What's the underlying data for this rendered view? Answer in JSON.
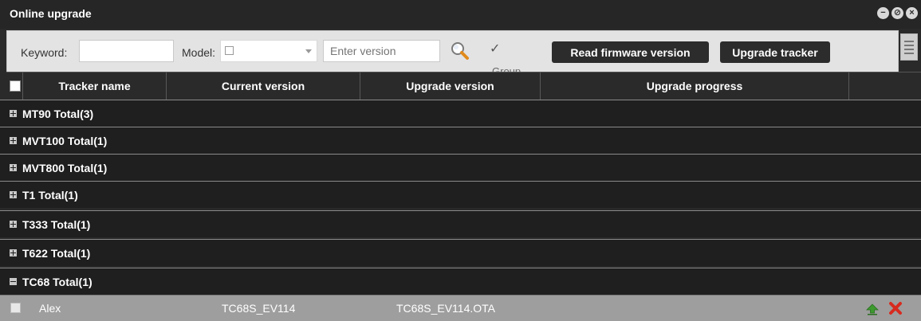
{
  "window": {
    "title": "Online upgrade",
    "controls": [
      "minimize",
      "restore",
      "close"
    ]
  },
  "toolbar": {
    "keyword_label": "Keyword:",
    "keyword_value": "",
    "model_label": "Model:",
    "version_placeholder": "Enter version",
    "group_label": "Group",
    "group_checked": true,
    "read_firmware_label": "Read firmware version",
    "upgrade_tracker_label": "Upgrade tracker"
  },
  "table": {
    "headers": [
      "Tracker name",
      "Current version",
      "Upgrade version",
      "Upgrade progress",
      ""
    ],
    "groups": [
      {
        "label": "MT90 Total(3)",
        "expanded": false
      },
      {
        "label": "MVT100 Total(1)",
        "expanded": false
      },
      {
        "label": "MVT800 Total(1)",
        "expanded": false
      },
      {
        "label": "T1 Total(1)",
        "expanded": false
      },
      {
        "label": "T333 Total(1)",
        "expanded": false
      },
      {
        "label": "T622 Total(1)",
        "expanded": false
      },
      {
        "label": "TC68 Total(1)",
        "expanded": true
      }
    ],
    "rows": [
      {
        "name": "Alex",
        "current_version": "TC68S_EV114",
        "upgrade_version": "TC68S_EV114.OTA",
        "progress": ""
      }
    ]
  },
  "colors": {
    "title_bg": "#262626",
    "group_bg": "#1f1f1f",
    "row_bg": "#9e9e9e",
    "button_bg": "#2c2c2c",
    "delete_red": "#d72b1f",
    "upgrade_green": "#3c9a2e"
  }
}
